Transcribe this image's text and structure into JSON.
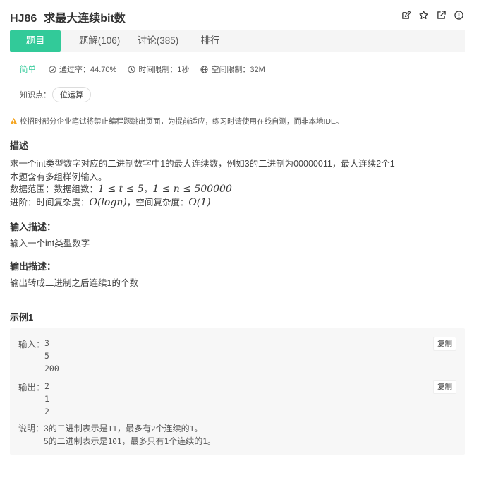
{
  "problem": {
    "id": "HJ86",
    "title": "求最大连续bit数"
  },
  "tabs": [
    {
      "label": "题目",
      "active": true
    },
    {
      "label": "题解(106)",
      "active": false
    },
    {
      "label": "讨论(385)",
      "active": false
    },
    {
      "label": "排行",
      "active": false
    }
  ],
  "meta": {
    "difficulty": "简单",
    "pass_rate": "通过率：44.70%",
    "time_limit": "时间限制：1秒",
    "space_limit": "空间限制：32M"
  },
  "knowledge": {
    "label": "知识点：",
    "tag": "位运算"
  },
  "warning": "校招时部分企业笔试将禁止编程题跳出页面，为提前适应，练习时请使用在线自测，而非本地IDE。",
  "description": {
    "heading": "描述",
    "line1": "求一个int类型数字对应的二进制数字中1的最大连续数，例如3的二进制为00000011，最大连续2个1",
    "line2": "本题含有多组样例输入。",
    "range_label": "数据范围：数据组数：",
    "range_math1": "1 ≤ t ≤ 5",
    "range_sep": "，",
    "range_math2": "1 ≤ n ≤ 500000",
    "adv_label": "进阶：时间复杂度：",
    "adv_math1": "O(logn)",
    "adv_mid": "，空间复杂度：",
    "adv_math2": "O(1)"
  },
  "input_desc": {
    "heading": "输入描述：",
    "text": "输入一个int类型数字"
  },
  "output_desc": {
    "heading": "输出描述：",
    "text": "输出转成二进制之后连续1的个数"
  },
  "example": {
    "heading": "示例1",
    "input_label": "输入：",
    "input_lines": [
      "3",
      "5",
      "200"
    ],
    "output_label": "输出：",
    "output_lines": [
      "2",
      "1",
      "2"
    ],
    "copy_label": "复制",
    "note_label": "说明：",
    "note_line1": {
      "a": "3的二进制表示是",
      "b": "11",
      "c": "，最多有",
      "d": "2",
      "e": "个连续的",
      "f": "1",
      "g": "。"
    },
    "note_line2": {
      "a": "5的二进制表示是",
      "b": "101",
      "c": "，最多只有",
      "d": "1",
      "e": "个连续的",
      "f": "1",
      "g": "。"
    }
  },
  "colors": {
    "accent": "#32ca99",
    "warning": "#f5a623"
  },
  "icons": [
    "edit-icon",
    "star-icon",
    "share-icon",
    "info-icon"
  ]
}
